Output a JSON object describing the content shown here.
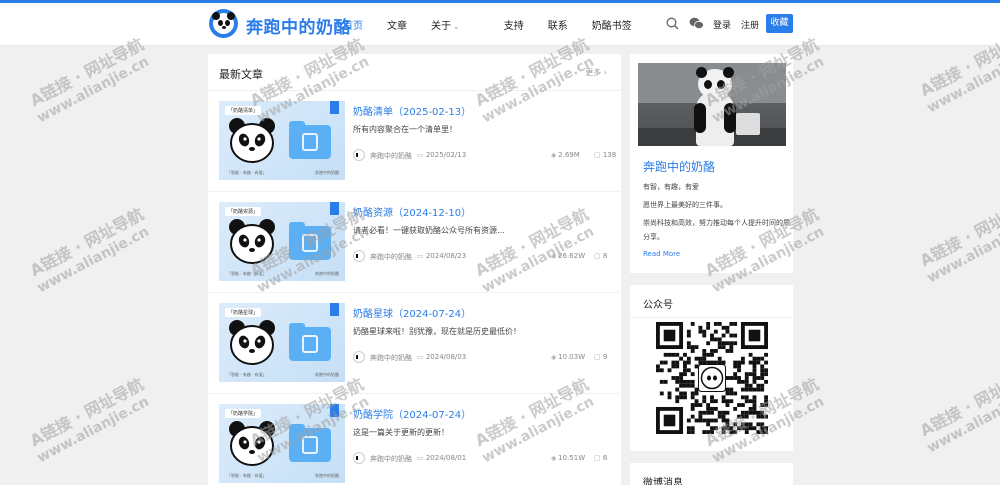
{
  "header": {
    "site_title": "奔跑中的奶酪",
    "nav": [
      {
        "label": "首页",
        "active": true
      },
      {
        "label": "文章",
        "active": false
      },
      {
        "label": "关于",
        "active": false,
        "has_dropdown": true
      },
      {
        "label": "支持",
        "active": false
      },
      {
        "label": "联系",
        "active": false
      },
      {
        "label": "奶酪书签",
        "active": false
      }
    ],
    "search_icon": "search-icon",
    "wechat_icon": "wechat-icon",
    "login_label": "登录",
    "register_label": "注册",
    "favorite_label": "收藏"
  },
  "main": {
    "title": "最新文章",
    "more_label": "更多",
    "posts": [
      {
        "title": "奶酪清单（2025-02-13）",
        "desc": "所有内容聚合在一个清单里！",
        "author": "奔跑中的奶酪",
        "date": "2025/02/13",
        "views": "2.69M",
        "comments": "138",
        "thumb_tag": "「奶酪清单」"
      },
      {
        "title": "奶酪资源（2024-12-10）",
        "desc": "请者必看！一键获取奶酪公众号所有资源…",
        "author": "奔跑中的奶酪",
        "date": "2024/08/23",
        "views": "26.62W",
        "comments": "8",
        "thumb_tag": "「奶酪资源」"
      },
      {
        "title": "奶酪星球（2024-07-24）",
        "desc": "奶酪星球来啦！别犹豫，现在就是历史最低价！",
        "author": "奔跑中的奶酪",
        "date": "2024/08/03",
        "views": "10.03W",
        "comments": "9",
        "thumb_tag": "「奶酪星球」"
      },
      {
        "title": "奶酪学院（2024-07-24）",
        "desc": "这是一篇关于更新的更新！",
        "author": "奔跑中的奶酪",
        "date": "2024/08/01",
        "views": "10.51W",
        "comments": "6",
        "thumb_tag": "「奶酪学院」"
      }
    ],
    "thumb_footer_left": "「智能 · 有趣 · 有爱」",
    "thumb_footer_right": "奔跑中的奶酪"
  },
  "sidebar": {
    "profile": {
      "name": "奔跑中的奶酪",
      "lines": [
        "有智，有趣，有爱",
        "愿世界上最美好的三件事。",
        "崇尚科技和高效，努力推动每个人提升时间的质",
        "分享。"
      ],
      "read_more": "Read More"
    },
    "wechat_title": "公众号",
    "weibo_title": "微博消息"
  },
  "watermark": {
    "line1": "A链接 · 网址导航",
    "line2": "www.alianjie.cn"
  },
  "colors": {
    "accent": "#2b7de9",
    "background": "#f0f0f0"
  }
}
